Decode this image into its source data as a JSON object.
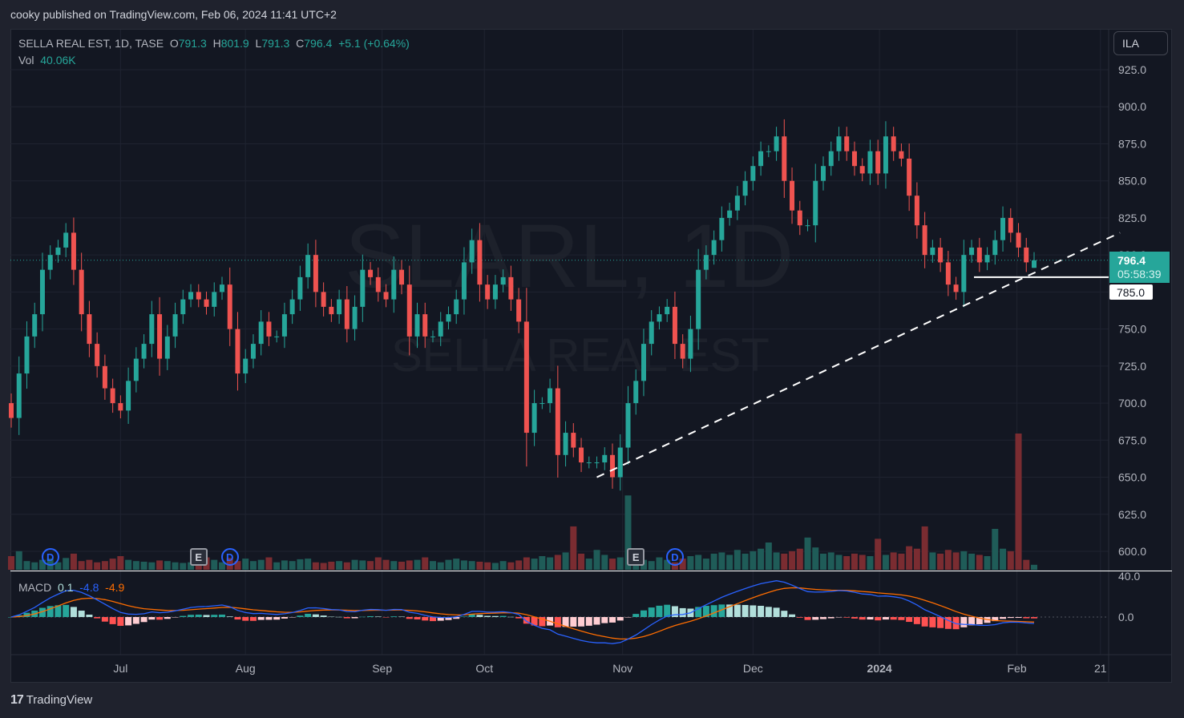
{
  "publisher": "cooky published on TradingView.com, Feb 06, 2024 11:41 UTC+2",
  "legend": {
    "symbol": "SELLA REAL EST, 1D, TASE",
    "o_label": "O",
    "o": "791.3",
    "h_label": "H",
    "h": "801.9",
    "l_label": "L",
    "l": "791.3",
    "c_label": "C",
    "c": "796.4",
    "change": "+5.1 (+0.64%)",
    "vol_label": "Vol",
    "vol": "40.06K"
  },
  "currency_button": "ILA",
  "watermark": {
    "line1": "SLARL, 1D",
    "line2": "SELLA REAL EST"
  },
  "macd_legend": {
    "label": "MACD",
    "hist": "0.1",
    "macd": "-4.8",
    "signal": "-4.9"
  },
  "current_price": {
    "price": "796.4",
    "countdown": "05:58:39"
  },
  "horizontal_line_label": "785.0",
  "brand": "TradingView",
  "colors": {
    "up": "#26a69a",
    "down": "#ef5350",
    "macd": "#2962ff",
    "signal": "#ff6d00"
  },
  "markers": [
    {
      "type": "D",
      "index": 5
    },
    {
      "type": "E",
      "index": 24
    },
    {
      "type": "D",
      "index": 28
    },
    {
      "type": "E",
      "index": 80
    },
    {
      "type": "D",
      "index": 85
    }
  ],
  "chart_data": {
    "type": "candlestick",
    "title": "SELLA REAL EST, 1D, TASE",
    "price_ticks": [
      "925.0",
      "900.0",
      "875.0",
      "850.0",
      "825.0",
      "800.0",
      "775.0",
      "750.0",
      "725.0",
      "700.0",
      "675.0",
      "650.0",
      "625.0",
      "600.0"
    ],
    "ylim": [
      600,
      925
    ],
    "time_ticks": [
      {
        "label": "Jul",
        "index": 14
      },
      {
        "label": "Aug",
        "index": 30
      },
      {
        "label": "Sep",
        "index": 47.5
      },
      {
        "label": "Oct",
        "index": 60.6
      },
      {
        "label": "Nov",
        "index": 78.3
      },
      {
        "label": "Dec",
        "index": 95
      },
      {
        "label": "2024",
        "index": 111.2,
        "bold": true
      },
      {
        "label": "Feb",
        "index": 128.8
      },
      {
        "label": "21",
        "index": 139.5
      }
    ],
    "first_open": 700,
    "last_bar": {
      "open": 791.3,
      "high": 801.9,
      "low": 791.3,
      "close": 796.4
    },
    "close": [
      690,
      720,
      745,
      760,
      790,
      800,
      805,
      815,
      790,
      760,
      740,
      725,
      710,
      700,
      695,
      715,
      730,
      740,
      760,
      730,
      745,
      760,
      770,
      775,
      770,
      765,
      775,
      780,
      750,
      720,
      730,
      740,
      755,
      745,
      745,
      760,
      770,
      785,
      800,
      775,
      765,
      760,
      770,
      750,
      765,
      790,
      785,
      775,
      770,
      790,
      780,
      745,
      760,
      745,
      745,
      755,
      760,
      770,
      795,
      810,
      780,
      770,
      780,
      785,
      770,
      755,
      680,
      700,
      700,
      710,
      665,
      680,
      670,
      660,
      660,
      660,
      665,
      650,
      670,
      700,
      715,
      740,
      755,
      760,
      765,
      740,
      730,
      750,
      790,
      800,
      810,
      825,
      830,
      840,
      850,
      860,
      870,
      870,
      880,
      850,
      830,
      820,
      820,
      850,
      860,
      870,
      880,
      870,
      860,
      855,
      870,
      855,
      880,
      870,
      865,
      840,
      820,
      800,
      805,
      795,
      780,
      775,
      800,
      805,
      795,
      800,
      810,
      825,
      815,
      805,
      795,
      796.4
    ],
    "volume_k": [
      110,
      150,
      70,
      60,
      80,
      90,
      60,
      95,
      130,
      70,
      80,
      60,
      70,
      90,
      110,
      80,
      70,
      65,
      60,
      75,
      70,
      60,
      55,
      60,
      70,
      100,
      80,
      60,
      95,
      70,
      90,
      70,
      80,
      100,
      60,
      75,
      70,
      85,
      90,
      60,
      55,
      65,
      70,
      60,
      80,
      75,
      70,
      100,
      80,
      70,
      65,
      75,
      80,
      100,
      70,
      60,
      80,
      90,
      75,
      70,
      65,
      60,
      55,
      70,
      60,
      75,
      100,
      90,
      110,
      100,
      120,
      140,
      350,
      130,
      90,
      160,
      120,
      90,
      100,
      600,
      90,
      80,
      70,
      100,
      80,
      60,
      90,
      110,
      120,
      90,
      130,
      140,
      120,
      160,
      130,
      150,
      170,
      220,
      140,
      130,
      150,
      170,
      260,
      180,
      130,
      140,
      120,
      110,
      130,
      120,
      110,
      250,
      120,
      140,
      130,
      190,
      170,
      350,
      140,
      130,
      160,
      140,
      150,
      130,
      120,
      110,
      330,
      170,
      150,
      1100,
      80,
      40.06
    ],
    "horizontal_line": 785.0,
    "trendline": [
      {
        "index": 75,
        "price": 650
      },
      {
        "index": 142,
        "price": 815
      }
    ]
  }
}
